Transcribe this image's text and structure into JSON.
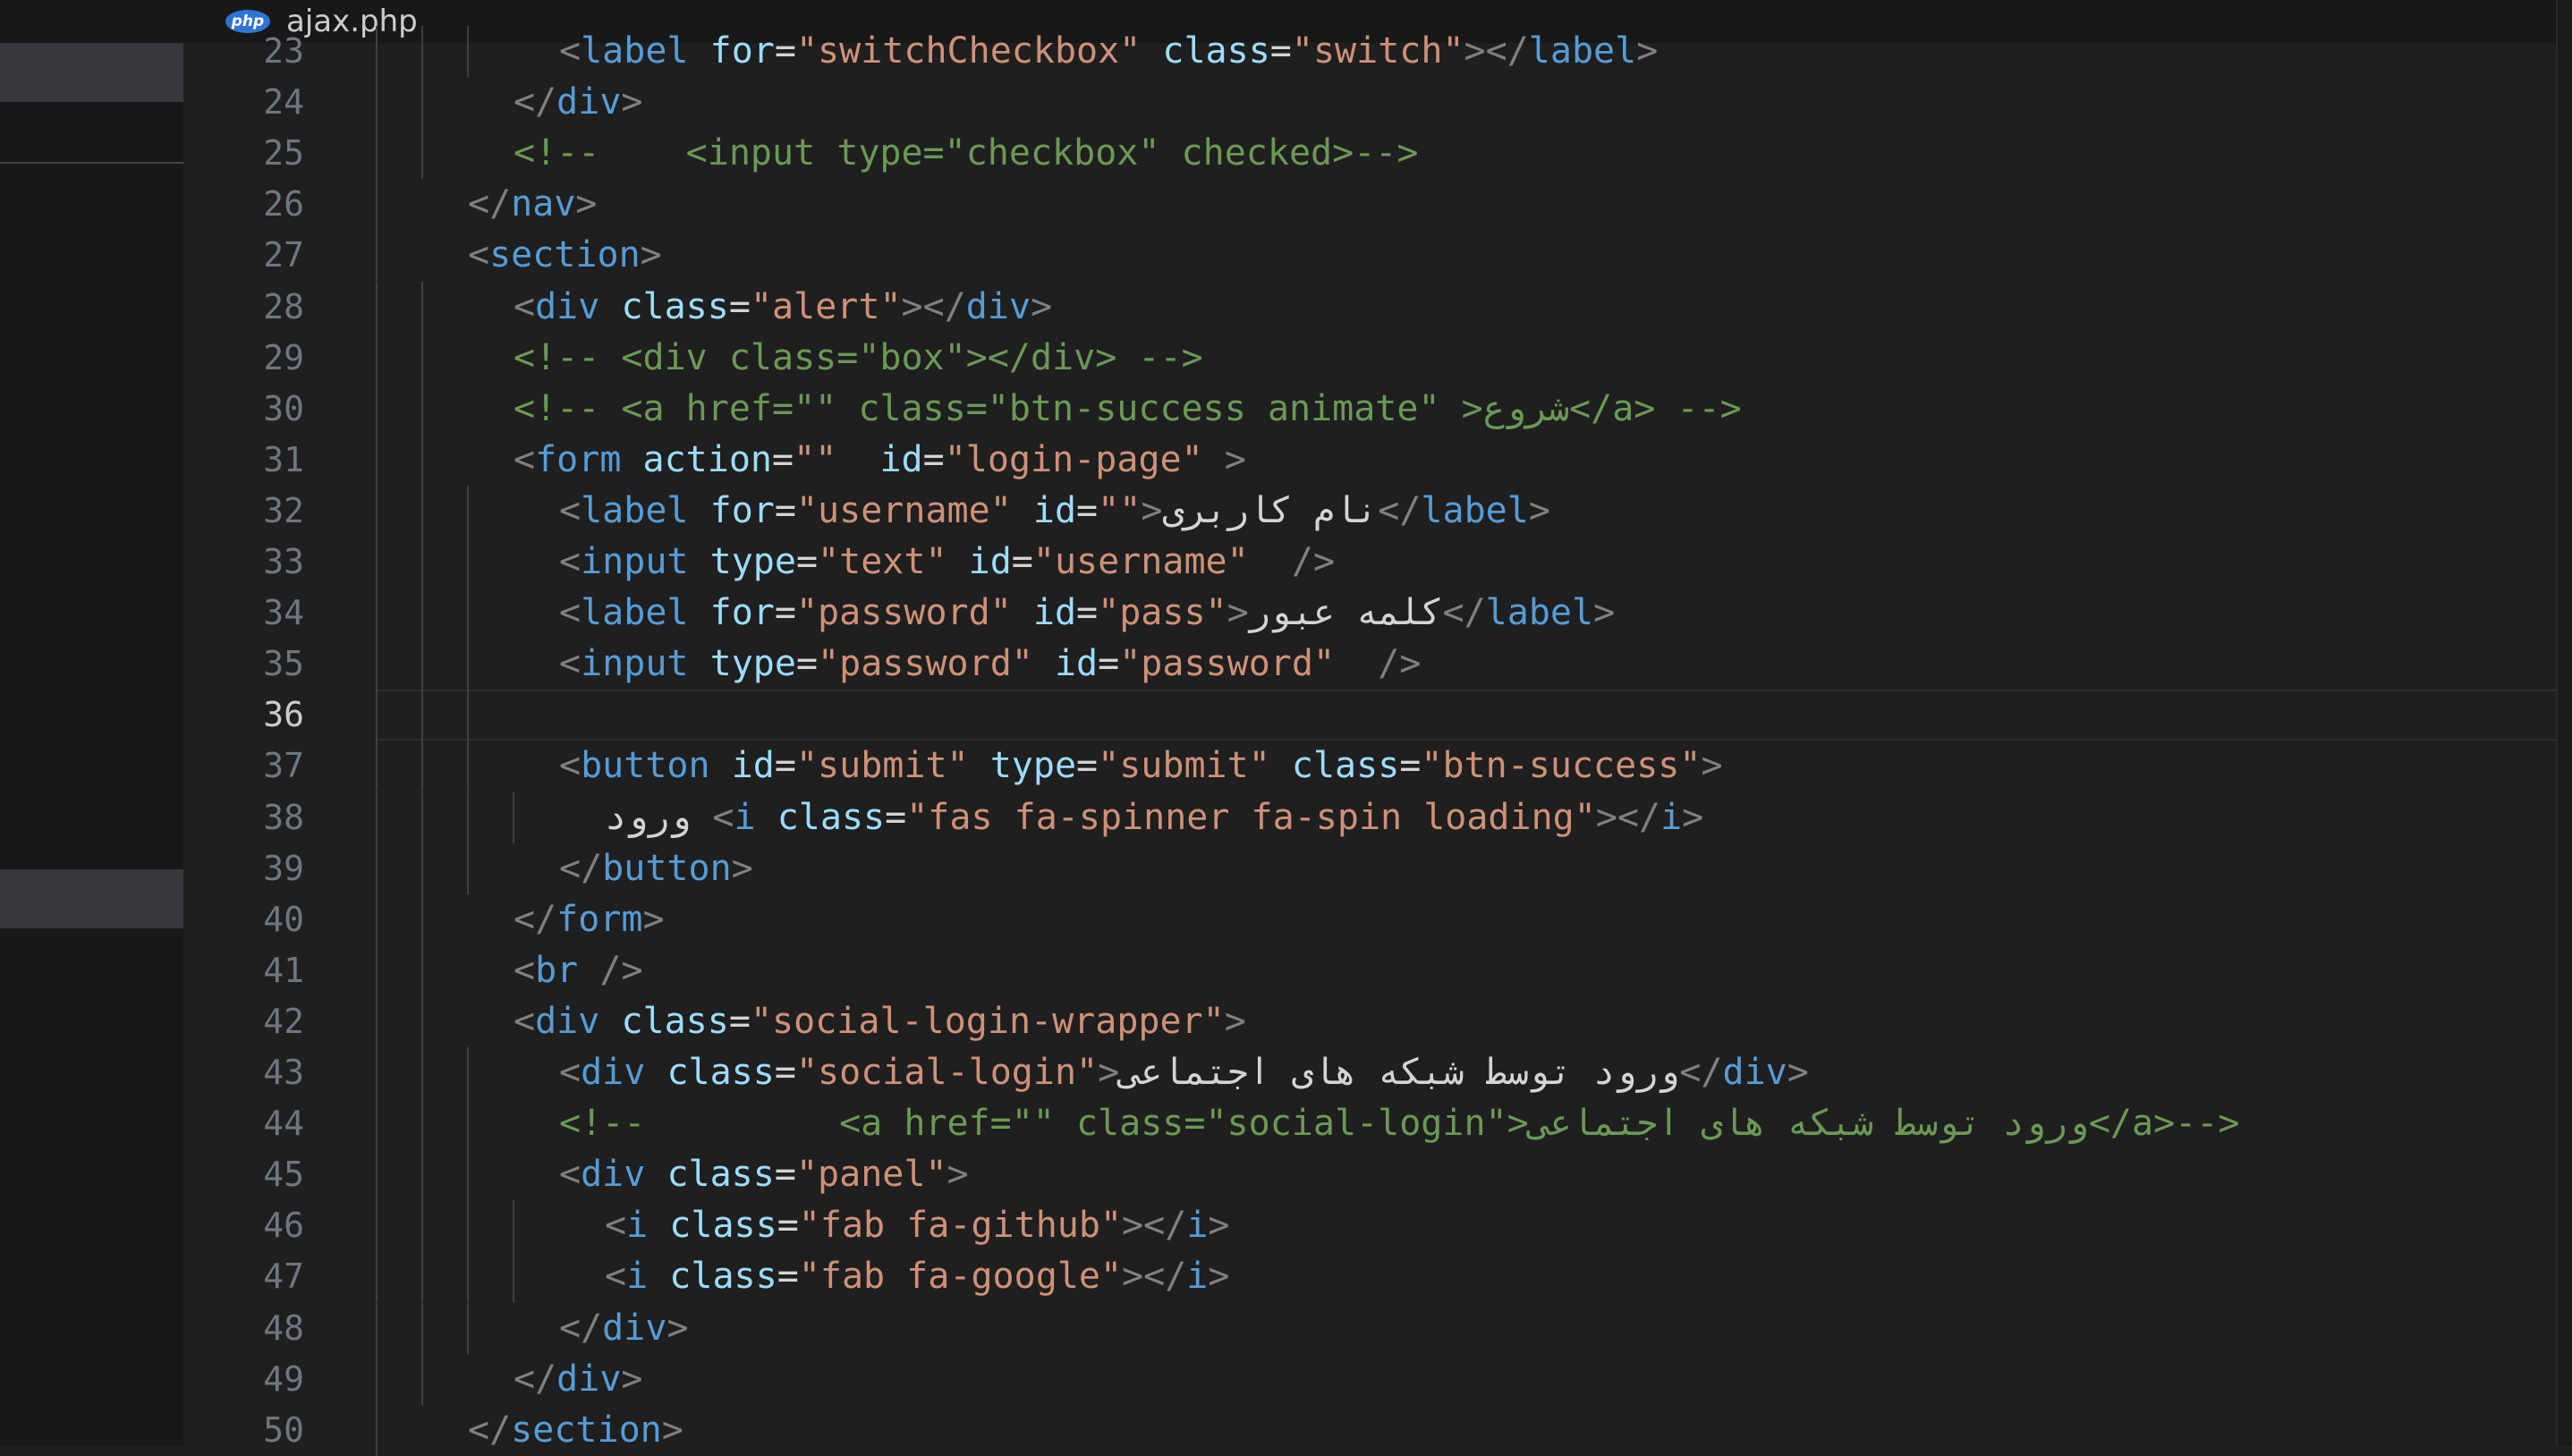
{
  "tab": {
    "icon": "php-file-icon",
    "icon_text": "php",
    "title": "ajax.php"
  },
  "editor": {
    "current_line": 36,
    "colors": {
      "punct": "#808080",
      "tag": "#569cd6",
      "attr": "#9cdcfe",
      "string": "#ce9178",
      "comment": "#6a9955",
      "text": "#d4d4d4"
    },
    "lines": [
      {
        "number": "23",
        "indent": 2,
        "tokens": [
          [
            "p",
            "<"
          ],
          [
            "tag",
            "label"
          ],
          [
            "text",
            " "
          ],
          [
            "attr",
            "for"
          ],
          [
            "text",
            "="
          ],
          [
            "str",
            "\"switchCheckbox\""
          ],
          [
            "text",
            " "
          ],
          [
            "attr",
            "class"
          ],
          [
            "text",
            "="
          ],
          [
            "str",
            "\"switch\""
          ],
          [
            "p",
            "></"
          ],
          [
            "tag",
            "label"
          ],
          [
            "p",
            ">"
          ]
        ]
      },
      {
        "number": "24",
        "indent": 1,
        "tokens": [
          [
            "p",
            "</"
          ],
          [
            "tag",
            "div"
          ],
          [
            "p",
            ">"
          ]
        ]
      },
      {
        "number": "25",
        "indent": 1,
        "tokens": [
          [
            "cmt",
            "<!--    <input type=\"checkbox\" checked>-->"
          ]
        ]
      },
      {
        "number": "26",
        "indent": 0,
        "tokens": [
          [
            "p",
            "</"
          ],
          [
            "tag",
            "nav"
          ],
          [
            "p",
            ">"
          ]
        ]
      },
      {
        "number": "27",
        "indent": 0,
        "tokens": [
          [
            "p",
            "<"
          ],
          [
            "tag",
            "section"
          ],
          [
            "p",
            ">"
          ]
        ]
      },
      {
        "number": "28",
        "indent": 1,
        "tokens": [
          [
            "p",
            "<"
          ],
          [
            "tag",
            "div"
          ],
          [
            "text",
            " "
          ],
          [
            "attr",
            "class"
          ],
          [
            "text",
            "="
          ],
          [
            "str",
            "\"alert\""
          ],
          [
            "p",
            "></"
          ],
          [
            "tag",
            "div"
          ],
          [
            "p",
            ">"
          ]
        ]
      },
      {
        "number": "29",
        "indent": 1,
        "tokens": [
          [
            "cmt",
            "<!-- <div class=\"box\"></div> -->"
          ]
        ]
      },
      {
        "number": "30",
        "indent": 1,
        "tokens": [
          [
            "cmt",
            "<!-- <a href=\"\" class=\"btn-success animate\" >شروع</a> -->"
          ]
        ]
      },
      {
        "number": "31",
        "indent": 1,
        "tokens": [
          [
            "p",
            "<"
          ],
          [
            "tag",
            "form"
          ],
          [
            "text",
            " "
          ],
          [
            "attr",
            "action"
          ],
          [
            "text",
            "="
          ],
          [
            "str",
            "\"\""
          ],
          [
            "text",
            "  "
          ],
          [
            "attr",
            "id"
          ],
          [
            "text",
            "="
          ],
          [
            "str",
            "\"login-page\""
          ],
          [
            "text",
            " "
          ],
          [
            "p",
            ">"
          ]
        ]
      },
      {
        "number": "32",
        "indent": 2,
        "tokens": [
          [
            "p",
            "<"
          ],
          [
            "tag",
            "label"
          ],
          [
            "text",
            " "
          ],
          [
            "attr",
            "for"
          ],
          [
            "text",
            "="
          ],
          [
            "str",
            "\"username\""
          ],
          [
            "text",
            " "
          ],
          [
            "attr",
            "id"
          ],
          [
            "text",
            "="
          ],
          [
            "str",
            "\"\""
          ],
          [
            "p",
            ">"
          ],
          [
            "text",
            "نام کاربری"
          ],
          [
            "p",
            "</"
          ],
          [
            "tag",
            "label"
          ],
          [
            "p",
            ">"
          ]
        ]
      },
      {
        "number": "33",
        "indent": 2,
        "tokens": [
          [
            "p",
            "<"
          ],
          [
            "tag",
            "input"
          ],
          [
            "text",
            " "
          ],
          [
            "attr",
            "type"
          ],
          [
            "text",
            "="
          ],
          [
            "str",
            "\"text\""
          ],
          [
            "text",
            " "
          ],
          [
            "attr",
            "id"
          ],
          [
            "text",
            "="
          ],
          [
            "str",
            "\"username\""
          ],
          [
            "text",
            "  "
          ],
          [
            "p",
            "/>"
          ]
        ]
      },
      {
        "number": "34",
        "indent": 2,
        "tokens": [
          [
            "p",
            "<"
          ],
          [
            "tag",
            "label"
          ],
          [
            "text",
            " "
          ],
          [
            "attr",
            "for"
          ],
          [
            "text",
            "="
          ],
          [
            "str",
            "\"password\""
          ],
          [
            "text",
            " "
          ],
          [
            "attr",
            "id"
          ],
          [
            "text",
            "="
          ],
          [
            "str",
            "\"pass\""
          ],
          [
            "p",
            ">"
          ],
          [
            "text",
            "کلمه عبور"
          ],
          [
            "p",
            "</"
          ],
          [
            "tag",
            "label"
          ],
          [
            "p",
            ">"
          ]
        ]
      },
      {
        "number": "35",
        "indent": 2,
        "tokens": [
          [
            "p",
            "<"
          ],
          [
            "tag",
            "input"
          ],
          [
            "text",
            " "
          ],
          [
            "attr",
            "type"
          ],
          [
            "text",
            "="
          ],
          [
            "str",
            "\"password\""
          ],
          [
            "text",
            " "
          ],
          [
            "attr",
            "id"
          ],
          [
            "text",
            "="
          ],
          [
            "str",
            "\"password\""
          ],
          [
            "text",
            "  "
          ],
          [
            "p",
            "/>"
          ]
        ]
      },
      {
        "number": "36",
        "indent": 2,
        "tokens": []
      },
      {
        "number": "37",
        "indent": 2,
        "tokens": [
          [
            "p",
            "<"
          ],
          [
            "tag",
            "button"
          ],
          [
            "text",
            " "
          ],
          [
            "attr",
            "id"
          ],
          [
            "text",
            "="
          ],
          [
            "str",
            "\"submit\""
          ],
          [
            "text",
            " "
          ],
          [
            "attr",
            "type"
          ],
          [
            "text",
            "="
          ],
          [
            "str",
            "\"submit\""
          ],
          [
            "text",
            " "
          ],
          [
            "attr",
            "class"
          ],
          [
            "text",
            "="
          ],
          [
            "str",
            "\"btn-success\""
          ],
          [
            "p",
            ">"
          ]
        ]
      },
      {
        "number": "38",
        "indent": 3,
        "tokens": [
          [
            "text",
            "ورود "
          ],
          [
            "p",
            "<"
          ],
          [
            "tag",
            "i"
          ],
          [
            "text",
            " "
          ],
          [
            "attr",
            "class"
          ],
          [
            "text",
            "="
          ],
          [
            "str",
            "\"fas fa-spinner fa-spin loading\""
          ],
          [
            "p",
            "></"
          ],
          [
            "tag",
            "i"
          ],
          [
            "p",
            ">"
          ]
        ]
      },
      {
        "number": "39",
        "indent": 2,
        "tokens": [
          [
            "p",
            "</"
          ],
          [
            "tag",
            "button"
          ],
          [
            "p",
            ">"
          ]
        ]
      },
      {
        "number": "40",
        "indent": 1,
        "tokens": [
          [
            "p",
            "</"
          ],
          [
            "tag",
            "form"
          ],
          [
            "p",
            ">"
          ]
        ]
      },
      {
        "number": "41",
        "indent": 1,
        "tokens": [
          [
            "p",
            "<"
          ],
          [
            "tag",
            "br"
          ],
          [
            "text",
            " "
          ],
          [
            "p",
            "/>"
          ]
        ]
      },
      {
        "number": "42",
        "indent": 1,
        "tokens": [
          [
            "p",
            "<"
          ],
          [
            "tag",
            "div"
          ],
          [
            "text",
            " "
          ],
          [
            "attr",
            "class"
          ],
          [
            "text",
            "="
          ],
          [
            "str",
            "\"social-login-wrapper\""
          ],
          [
            "p",
            ">"
          ]
        ]
      },
      {
        "number": "43",
        "indent": 2,
        "tokens": [
          [
            "p",
            "<"
          ],
          [
            "tag",
            "div"
          ],
          [
            "text",
            " "
          ],
          [
            "attr",
            "class"
          ],
          [
            "text",
            "="
          ],
          [
            "str",
            "\"social-login\""
          ],
          [
            "p",
            ">"
          ],
          [
            "text",
            "ورود توسط شبکه های اجتماعی"
          ],
          [
            "p",
            "</"
          ],
          [
            "tag",
            "div"
          ],
          [
            "p",
            ">"
          ]
        ]
      },
      {
        "number": "44",
        "indent": 2,
        "tokens": [
          [
            "cmt",
            "<!--         <a href=\"\" class=\"social-login\">ورود توسط شبکه های اجتماعی</a>-->"
          ]
        ]
      },
      {
        "number": "45",
        "indent": 2,
        "tokens": [
          [
            "p",
            "<"
          ],
          [
            "tag",
            "div"
          ],
          [
            "text",
            " "
          ],
          [
            "attr",
            "class"
          ],
          [
            "text",
            "="
          ],
          [
            "str",
            "\"panel\""
          ],
          [
            "p",
            ">"
          ]
        ]
      },
      {
        "number": "46",
        "indent": 3,
        "tokens": [
          [
            "p",
            "<"
          ],
          [
            "tag",
            "i"
          ],
          [
            "text",
            " "
          ],
          [
            "attr",
            "class"
          ],
          [
            "text",
            "="
          ],
          [
            "str",
            "\"fab fa-github\""
          ],
          [
            "p",
            "></"
          ],
          [
            "tag",
            "i"
          ],
          [
            "p",
            ">"
          ]
        ]
      },
      {
        "number": "47",
        "indent": 3,
        "tokens": [
          [
            "p",
            "<"
          ],
          [
            "tag",
            "i"
          ],
          [
            "text",
            " "
          ],
          [
            "attr",
            "class"
          ],
          [
            "text",
            "="
          ],
          [
            "str",
            "\"fab fa-google\""
          ],
          [
            "p",
            "></"
          ],
          [
            "tag",
            "i"
          ],
          [
            "p",
            ">"
          ]
        ]
      },
      {
        "number": "48",
        "indent": 2,
        "tokens": [
          [
            "p",
            "</"
          ],
          [
            "tag",
            "div"
          ],
          [
            "p",
            ">"
          ]
        ]
      },
      {
        "number": "49",
        "indent": 1,
        "tokens": [
          [
            "p",
            "</"
          ],
          [
            "tag",
            "div"
          ],
          [
            "p",
            ">"
          ]
        ]
      },
      {
        "number": "50",
        "indent": 0,
        "tokens": [
          [
            "p",
            "</"
          ],
          [
            "tag",
            "section"
          ],
          [
            "p",
            ">"
          ]
        ]
      }
    ]
  }
}
